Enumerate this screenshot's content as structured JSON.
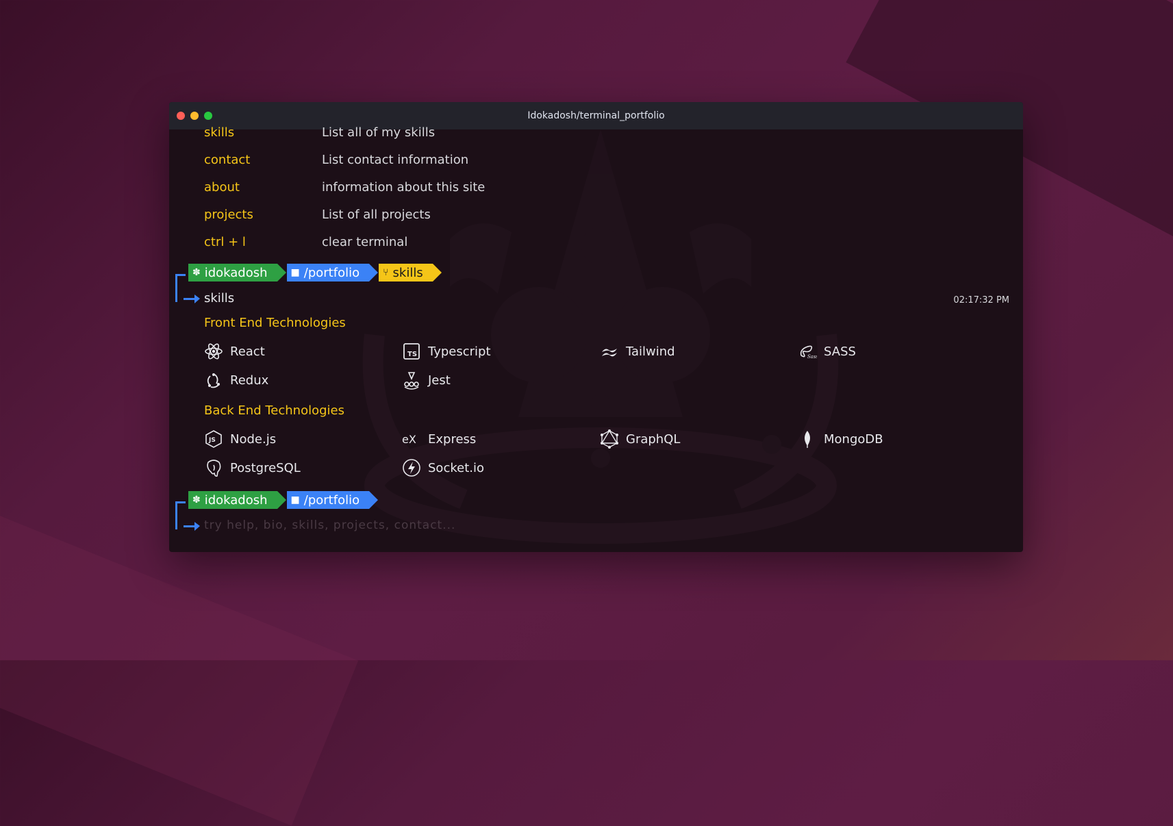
{
  "window": {
    "title": "Idokadosh/terminal_portfolio"
  },
  "help_list": [
    {
      "cmd": "skills",
      "desc": "List all of my skills"
    },
    {
      "cmd": "contact",
      "desc": "List contact information"
    },
    {
      "cmd": "about",
      "desc": "information about this site"
    },
    {
      "cmd": "projects",
      "desc": "List of all projects"
    },
    {
      "cmd": "ctrl + l",
      "desc": "clear terminal"
    }
  ],
  "prompt1": {
    "user": "idokadosh",
    "path": "/portfolio",
    "branch": "skills"
  },
  "command1": "skills",
  "timestamp": "02:17:32 PM",
  "frontend": {
    "title": "Front End Technologies",
    "items": [
      "React",
      "Typescript",
      "Tailwind",
      "SASS",
      "Redux",
      "Jest"
    ]
  },
  "backend": {
    "title": "Back End Technologies",
    "items": [
      "Node.js",
      "Express",
      "GraphQL",
      "MongoDB",
      "PostgreSQL",
      "Socket.io"
    ]
  },
  "prompt2": {
    "user": "idokadosh",
    "path": "/portfolio"
  },
  "input": {
    "placeholder": "try help, bio, skills, projects, contact..."
  },
  "colors": {
    "accent_yellow": "#f5c518",
    "user_green": "#2ea043",
    "path_blue": "#3b82f6"
  }
}
